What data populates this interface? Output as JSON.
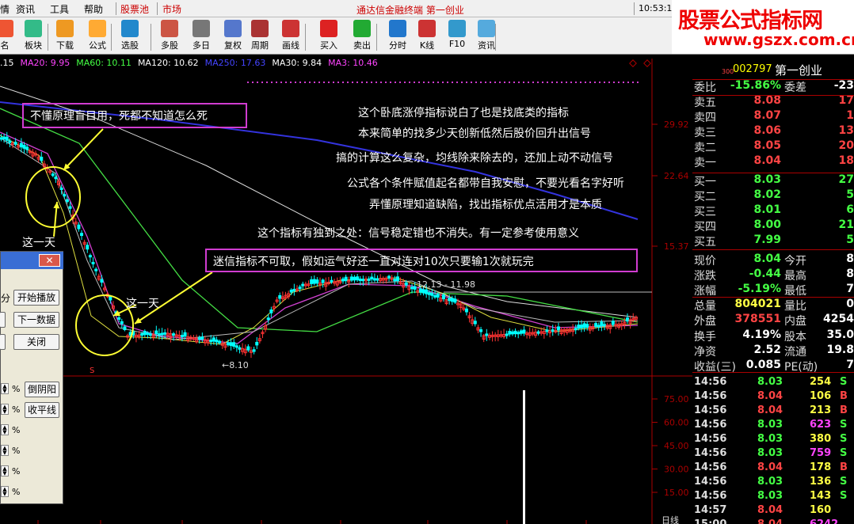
{
  "menu": {
    "items": [
      "情",
      "资讯",
      "工具",
      "帮助",
      "股票池",
      "市场"
    ],
    "title": "通达信金融终端 第一创业",
    "clock": "10:53:11"
  },
  "toolbar": [
    "名",
    "板块",
    "下载",
    "公式",
    "选股",
    "多股",
    "多日",
    "复权",
    "周期",
    "画线",
    "买入",
    "卖出",
    "分时",
    "K线",
    "F10",
    "资讯"
  ],
  "watermark": {
    "line1": "股票公式指标网",
    "line2": "www.gszx.com.cn"
  },
  "ma_legend": [
    {
      "text": ".15",
      "color": "#ffffff"
    },
    {
      "text": "MA20: 9.95",
      "color": "#ff44ff"
    },
    {
      "text": "MA60: 10.11",
      "color": "#44ff44"
    },
    {
      "text": "MA120: 10.62",
      "color": "#ffffff"
    },
    {
      "text": "MA250: 17.63",
      "color": "#4444ff"
    },
    {
      "text": "MA30: 9.84",
      "color": "#ffffff"
    },
    {
      "text": "MA3: 10.46",
      "color": "#ff44ff"
    }
  ],
  "stock": {
    "prefix": "300",
    "code": "002797",
    "name": "第一创业"
  },
  "price_axis": [
    "29.92",
    "22.64",
    "15.37"
  ],
  "ind_axis": [
    "75.00",
    "60.00",
    "45.00",
    "30.00",
    "15.00"
  ],
  "price_labels": {
    "low": "8.10",
    "high": "12.13",
    "high2": "11.98",
    "volume_label": "日线"
  },
  "annotations": {
    "box1": "不懂原理盲目用，死都不知道怎么死",
    "box2": "迷信指标不可取，假如运气好还一直对连对10次只要输1次就玩完",
    "lines": [
      "这个卧底涨停指标说白了也是找底类的指标",
      "本来简单的找多少天创新低然后股价回升出信号",
      "搞的计算这么复杂，均线除来除去的，还加上动不动信号",
      "公式各个条件赋值起名都带自我安慰，不要光看名字好听",
      "弄懂原理知道缺陷，找出指标优点活用才是本质",
      "这个指标有独到之处：信号稳定错也不消失。有一定参考使用意义"
    ],
    "day1": "这一天",
    "day2": "这一天"
  },
  "quote": {
    "rows": [
      {
        "l": "委比",
        "v": "-15.86%",
        "l2": "委差",
        "v2": "-23",
        "vc": "#44ff44"
      },
      {
        "l": "卖五",
        "v": "8.08",
        "l2": "",
        "v2": "17",
        "vc": "#ff4444"
      },
      {
        "l": "卖四",
        "v": "8.07",
        "l2": "",
        "v2": "1",
        "vc": "#ff4444"
      },
      {
        "l": "卖三",
        "v": "8.06",
        "l2": "",
        "v2": "13",
        "vc": "#ff4444"
      },
      {
        "l": "卖二",
        "v": "8.05",
        "l2": "",
        "v2": "20",
        "vc": "#ff4444"
      },
      {
        "l": "卖一",
        "v": "8.04",
        "l2": "",
        "v2": "18",
        "vc": "#ff4444"
      },
      {
        "l": "买一",
        "v": "8.03",
        "l2": "",
        "v2": "27",
        "vc": "#44ff44"
      },
      {
        "l": "买二",
        "v": "8.02",
        "l2": "",
        "v2": "5",
        "vc": "#44ff44"
      },
      {
        "l": "买三",
        "v": "8.01",
        "l2": "",
        "v2": "6",
        "vc": "#44ff44"
      },
      {
        "l": "买四",
        "v": "8.00",
        "l2": "",
        "v2": "21",
        "vc": "#44ff44"
      },
      {
        "l": "买五",
        "v": "7.99",
        "l2": "",
        "v2": "5",
        "vc": "#44ff44"
      },
      {
        "l": "现价",
        "v": "8.04",
        "l2": "今开",
        "v2": "8",
        "vc": "#44ff44"
      },
      {
        "l": "涨跌",
        "v": "-0.44",
        "l2": "最高",
        "v2": "8",
        "vc": "#44ff44"
      },
      {
        "l": "涨幅",
        "v": "-5.19%",
        "l2": "最低",
        "v2": "7",
        "vc": "#44ff44"
      },
      {
        "l": "总量",
        "v": "804021",
        "l2": "量比",
        "v2": "0",
        "vc": "#ffff44"
      },
      {
        "l": "外盘",
        "v": "378551",
        "l2": "内盘",
        "v2": "4254",
        "vc": "#ff4444"
      },
      {
        "l": "换手",
        "v": "4.19%",
        "l2": "股本",
        "v2": "35.0",
        "vc": "#ffffff"
      },
      {
        "l": "净资",
        "v": "2.52",
        "l2": "流通",
        "v2": "19.8",
        "vc": "#ffffff"
      },
      {
        "l": "收益(三)",
        "v": "0.085",
        "l2": "PE(动)",
        "v2": "7",
        "vc": "#ffffff"
      }
    ]
  },
  "trades": [
    {
      "t": "14:56",
      "p": "8.03",
      "v": "254",
      "s": "S",
      "vc": "#ffff44"
    },
    {
      "t": "14:56",
      "p": "8.04",
      "v": "106",
      "s": "B",
      "vc": "#ffff44"
    },
    {
      "t": "14:56",
      "p": "8.04",
      "v": "213",
      "s": "B",
      "vc": "#ffff44"
    },
    {
      "t": "14:56",
      "p": "8.03",
      "v": "623",
      "s": "S",
      "vc": "#ff44ff"
    },
    {
      "t": "14:56",
      "p": "8.03",
      "v": "380",
      "s": "S",
      "vc": "#ffff44"
    },
    {
      "t": "14:56",
      "p": "8.03",
      "v": "759",
      "s": "S",
      "vc": "#ff44ff"
    },
    {
      "t": "14:56",
      "p": "8.04",
      "v": "178",
      "s": "B",
      "vc": "#ffff44"
    },
    {
      "t": "14:56",
      "p": "8.03",
      "v": "136",
      "s": "S",
      "vc": "#ffff44"
    },
    {
      "t": "14:56",
      "p": "8.03",
      "v": "143",
      "s": "S",
      "vc": "#ffff44"
    },
    {
      "t": "14:57",
      "p": "8.04",
      "v": "160",
      "s": "",
      "vc": "#ffff44"
    },
    {
      "t": "15:00",
      "p": "8.04",
      "v": "6242",
      "s": "",
      "vc": "#ff44ff"
    }
  ],
  "dialog": {
    "btn_play": "开始播放",
    "btn_next": "下一数据",
    "btn_close": "关闭",
    "btn_yinyang": "倒阴阳",
    "btn_flat": "收平线",
    "left_cut": "分",
    "close_x": "✕",
    "pct": "%"
  },
  "colors": {
    "up": "#ff3333",
    "down": "#00ffff",
    "bg": "#000000"
  }
}
